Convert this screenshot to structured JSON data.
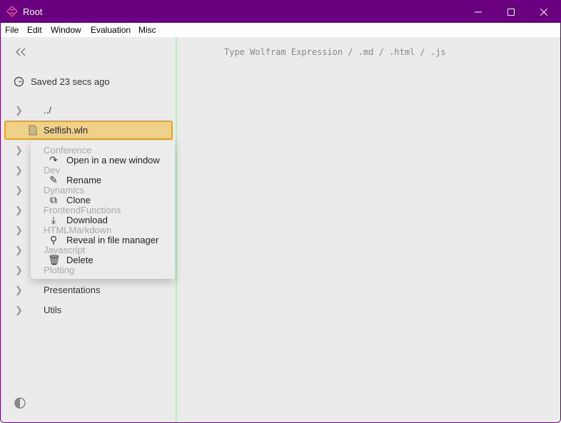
{
  "window": {
    "title": "Root",
    "accent": "#6a0080"
  },
  "menubar": [
    "File",
    "Edit",
    "Window",
    "Evaluation",
    "Misc"
  ],
  "sidebar": {
    "status": "Saved 23 secs ago",
    "parent": "../",
    "selected_file": "Selfish.wln",
    "folders": [
      "Conference",
      "Dev",
      "Dynamics",
      "FrontendFunctions",
      "HTMLMarkdown",
      "Javascript",
      "Plotting",
      "Presentations",
      "Utils"
    ]
  },
  "context_menu": [
    {
      "icon": "arrow-forward-icon",
      "label": "Open in a new window"
    },
    {
      "icon": "edit-icon",
      "label": "Rename"
    },
    {
      "icon": "copy-icon",
      "label": "Clone"
    },
    {
      "icon": "download-icon",
      "label": "Download"
    },
    {
      "icon": "search-icon",
      "label": "Reveal in file manager"
    },
    {
      "icon": "trash-icon",
      "label": "Delete"
    }
  ],
  "editor": {
    "placeholder": "Type Wolfram Expression / .md / .html / .js"
  }
}
